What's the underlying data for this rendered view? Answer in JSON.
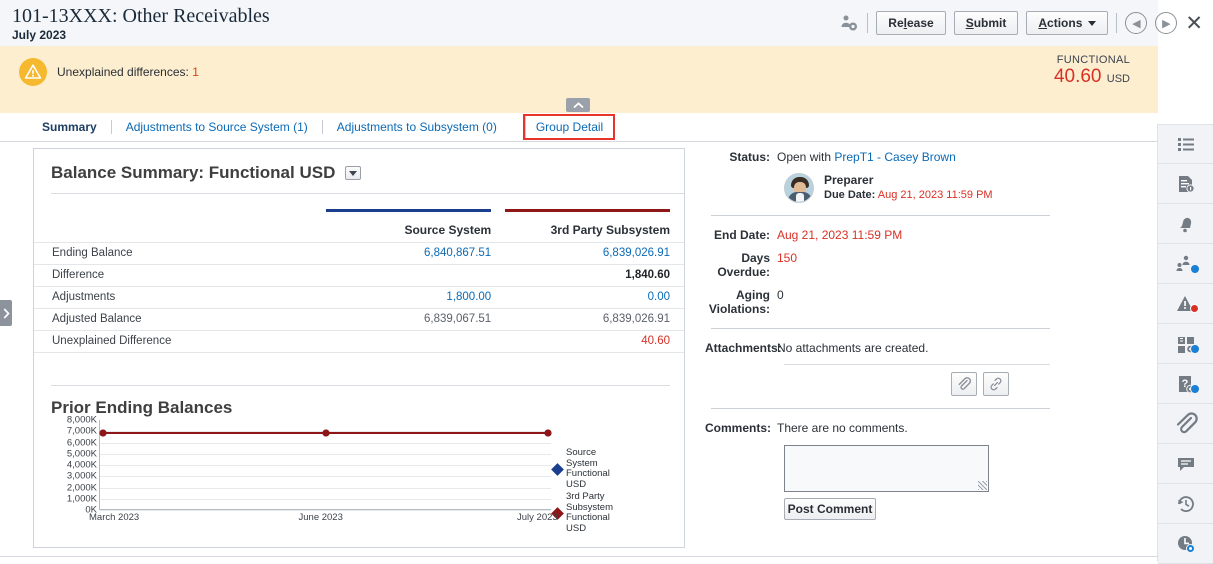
{
  "header": {
    "title": "101-13XXX: Other Receivables",
    "subtitle": "July 2023",
    "user_icon": "user-settings-icon",
    "buttons": [
      {
        "name": "release-button",
        "label_pre": "Re",
        "label_key": "l",
        "label_post": "ease",
        "full": "Release"
      },
      {
        "name": "submit-button",
        "label_pre": "",
        "label_key": "S",
        "label_post": "ubmit",
        "full": "Submit"
      },
      {
        "name": "actions-button",
        "label_pre": "",
        "label_key": "A",
        "label_post": "ctions",
        "full": "Actions"
      }
    ],
    "nav_prev_icon": "chevron-left-circle-icon",
    "nav_next_icon": "chevron-right-circle-icon",
    "close_icon": "close-icon"
  },
  "banner": {
    "warning_icon": "warning-triangle-icon",
    "message_prefix": "Unexplained differences: ",
    "message_count": "1",
    "functional_label": "FUNCTIONAL",
    "functional_amount": "40.60",
    "functional_currency": "USD",
    "collapse_icon": "chevron-up-icon"
  },
  "tabs": [
    {
      "name": "tab-summary",
      "label": "Summary",
      "active": true,
      "highlight": false
    },
    {
      "name": "tab-adjustments-source-system",
      "label": "Adjustments to Source System (1)",
      "active": false,
      "highlight": false
    },
    {
      "name": "tab-adjustments-subsystem",
      "label": "Adjustments to Subsystem (0)",
      "active": false,
      "highlight": false
    },
    {
      "name": "tab-group-detail",
      "label": "Group Detail",
      "active": false,
      "highlight": true
    }
  ],
  "left_handle": {
    "icon": "chevron-right-icon"
  },
  "card": {
    "title": "Balance Summary: Functional USD",
    "dropdown_icon": "chevron-down-icon",
    "table": {
      "columns": [
        {
          "label": "Source System",
          "accent": "#1b3f8f"
        },
        {
          "label": "3rd Party Subsystem",
          "accent": "#8f1616"
        }
      ],
      "rows": [
        {
          "label": "Ending Balance",
          "source": "6,840,867.51",
          "source_style": "link",
          "subsystem": "6,839,026.91",
          "subsystem_style": "link"
        },
        {
          "label": "Difference",
          "source": "",
          "source_style": "plain",
          "subsystem": "1,840.60",
          "subsystem_style": "bold"
        },
        {
          "label": "Adjustments",
          "source": "1,800.00",
          "source_style": "link",
          "subsystem": "0.00",
          "subsystem_style": "link"
        },
        {
          "label": "Adjusted Balance",
          "source": "6,839,067.51",
          "source_style": "plain",
          "subsystem": "6,839,026.91",
          "subsystem_style": "plain"
        },
        {
          "label": "Unexplained Difference",
          "source": "",
          "source_style": "plain",
          "subsystem": "40.60",
          "subsystem_style": "red"
        }
      ]
    }
  },
  "chart_data": {
    "type": "line",
    "title": "Prior Ending Balances",
    "xlabel": "",
    "ylabel": "",
    "categories": [
      "March 2023",
      "June 2023",
      "July 2023"
    ],
    "ytick_labels": [
      "8,000K",
      "7,000K",
      "6,000K",
      "5,000K",
      "4,000K",
      "3,000K",
      "2,000K",
      "1,000K",
      "0K"
    ],
    "ylim": [
      0,
      8000000
    ],
    "grid": true,
    "legend_position": "right",
    "series": [
      {
        "name": "Source System Functional USD",
        "color": "#1b3f8f",
        "values": [
          6840867.51,
          6840867.51,
          6840867.51
        ]
      },
      {
        "name": "3rd Party Subsystem Functional USD",
        "color": "#8f1616",
        "values": [
          6839026.91,
          6839026.91,
          6839026.91
        ]
      }
    ],
    "legend": [
      {
        "label_lines": [
          "Source",
          "System",
          "Functional",
          "USD"
        ],
        "color": "#1b3f8f"
      },
      {
        "label_lines": [
          "3rd Party",
          "Subsystem",
          "Functional",
          "USD"
        ],
        "color": "#8f1616"
      }
    ]
  },
  "detail": {
    "status_label": "Status:",
    "status_prefix": "Open with ",
    "status_link": "PrepT1 - Casey Brown",
    "preparer_role": "Preparer",
    "preparer_due_label": "Due Date:",
    "preparer_due_value": "Aug 21, 2023 11:59 PM",
    "end_date_label": "End Date:",
    "end_date_value": "Aug 21, 2023 11:59 PM",
    "days_overdue_label": "Days Overdue:",
    "days_overdue_value": "150",
    "aging_violations_label": "Aging Violations:",
    "aging_violations_value": "0",
    "attachments_label": "Attachments:",
    "attachments_value": "No attachments are created.",
    "attach_file_icon": "paperclip-icon",
    "attach_link_icon": "link-icon",
    "comments_label": "Comments:",
    "comments_value": "There are no comments.",
    "comment_placeholder": "",
    "comment_value": "",
    "post_comment_label": "Post Comment"
  },
  "rail": [
    {
      "name": "rail-item-tasks",
      "icon": "list-icon"
    },
    {
      "name": "rail-item-document",
      "icon": "document-info-icon"
    },
    {
      "name": "rail-item-workflow",
      "icon": "bell-icon"
    },
    {
      "name": "rail-item-users",
      "icon": "users-settings-icon"
    },
    {
      "name": "rail-item-alerts",
      "icon": "alert-triangle-icon"
    },
    {
      "name": "rail-item-rules",
      "icon": "grid-settings-icon"
    },
    {
      "name": "rail-item-questions",
      "icon": "question-settings-icon"
    },
    {
      "name": "rail-item-attachments",
      "icon": "paperclip-icon"
    },
    {
      "name": "rail-item-comments",
      "icon": "comment-icon"
    },
    {
      "name": "rail-item-history",
      "icon": "history-icon"
    },
    {
      "name": "rail-item-schedule",
      "icon": "clock-settings-icon"
    }
  ]
}
